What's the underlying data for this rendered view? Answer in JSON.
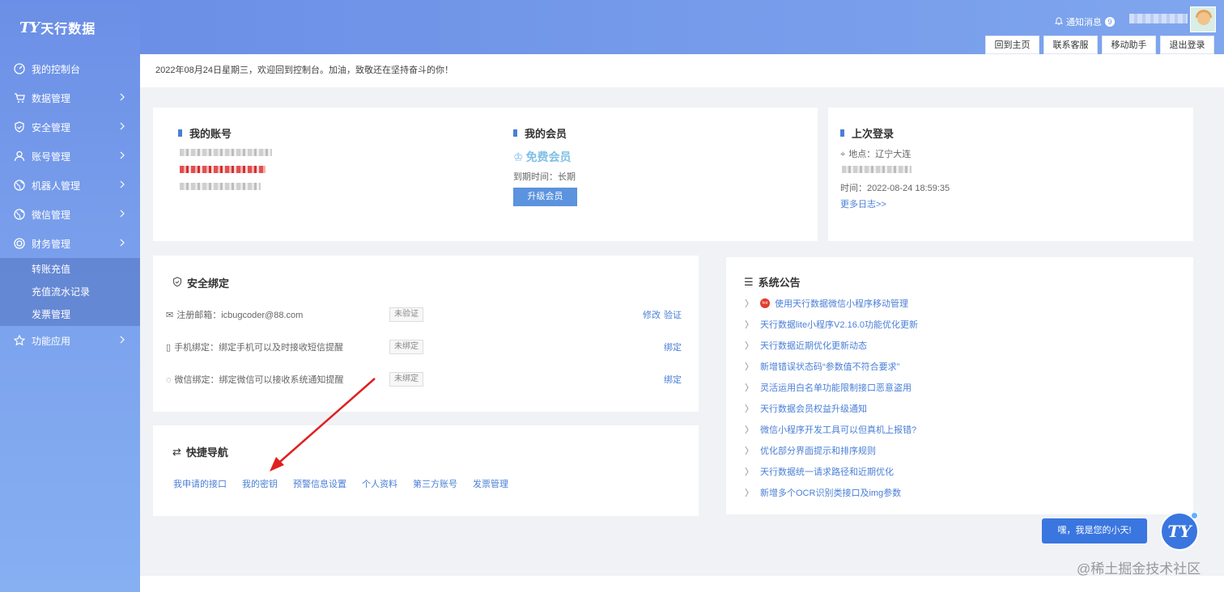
{
  "brand": {
    "mark": "TY",
    "title": "天行数据"
  },
  "sidebar": {
    "items": [
      {
        "label": "我的控制台",
        "icon": "gauge-icon"
      },
      {
        "label": "数据管理",
        "icon": "cart-icon"
      },
      {
        "label": "安全管理",
        "icon": "shield-icon"
      },
      {
        "label": "账号管理",
        "icon": "user-icon"
      },
      {
        "label": "机器人管理",
        "icon": "globe-icon"
      },
      {
        "label": "微信管理",
        "icon": "globe-icon"
      },
      {
        "label": "财务管理",
        "icon": "finance-icon"
      },
      {
        "label": "功能应用",
        "icon": "star-icon"
      }
    ],
    "finance_sub": [
      "转账充值",
      "充值流水记录",
      "发票管理"
    ]
  },
  "header": {
    "notice_label": "通知消息",
    "notice_count": "9",
    "buttons": [
      "回到主页",
      "联系客服",
      "移动助手",
      "退出登录"
    ]
  },
  "welcome": "2022年08月24日星期三，欢迎回到控制台。加油，致敬还在坚持奋斗的你！",
  "account": {
    "title": "我的账号"
  },
  "membership": {
    "title": "我的会员",
    "level": "免费会员",
    "expire": "到期时间：长期",
    "upgrade": "升级会员"
  },
  "last_login": {
    "title": "上次登录",
    "location": "地点：辽宁大连",
    "time": "时间：2022-08-24 18:59:35",
    "more": "更多日志>>"
  },
  "security": {
    "title": "安全绑定",
    "rows": [
      {
        "label": "注册邮箱：",
        "value": "icbugcoder@88.com",
        "status": "未验证",
        "actions": [
          "修改",
          "验证"
        ]
      },
      {
        "label": "手机绑定：",
        "value": "绑定手机可以及时接收短信提醒",
        "status": "未绑定",
        "actions": [
          "绑定"
        ]
      },
      {
        "label": "微信绑定：",
        "value": "绑定微信可以接收系统通知提醒",
        "status": "未绑定",
        "actions": [
          "绑定"
        ]
      }
    ]
  },
  "quick_nav": {
    "title": "快捷导航",
    "links": [
      "我申请的接口",
      "我的密钥",
      "预警信息设置",
      "个人资料",
      "第三方账号",
      "发票管理"
    ]
  },
  "announcements": {
    "title": "系统公告",
    "items": [
      "使用天行数据微信小程序移动管理",
      "天行数据lite小程序V2.16.0功能优化更新",
      "天行数据近期优化更新动态",
      "新增错误状态码“参数值不符合要求”",
      "灵活运用白名单功能限制接口恶意盗用",
      "天行数据会员权益升级通知",
      "微信小程序开发工具可以但真机上报错?",
      "优化部分界面提示和排序规则",
      "天行数据统一请求路径和近期优化",
      "新增多个OCR识别类接口及img参数"
    ],
    "hot_badge": "hot"
  },
  "chat": {
    "bubble": "嘿，我是您的小天!",
    "avatar": "TY"
  },
  "watermark": "@稀土掘金技术社区",
  "colors": {
    "accent": "#4a7fd6",
    "sidebar": "#6b8fe6",
    "arrow": "#e02020"
  }
}
